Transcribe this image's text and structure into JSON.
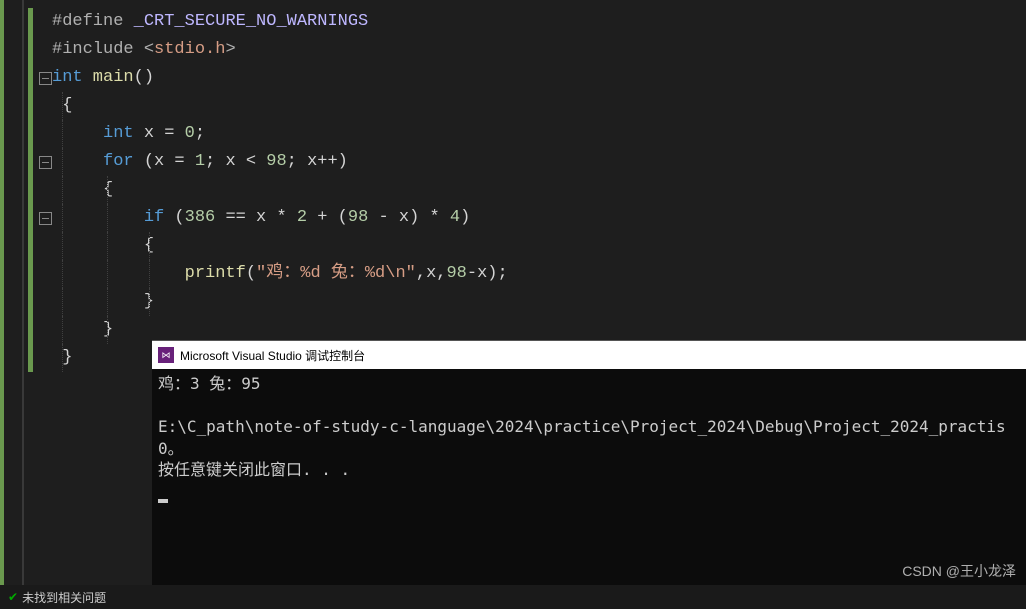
{
  "code": {
    "l1_define": "#define",
    "l1_macro": " _CRT_SECURE_NO_WARNINGS",
    "l2_include": "#include ",
    "l2_open": "<",
    "l2_hdr": "stdio.h",
    "l2_close": ">",
    "l3_int": "int",
    "l3_main": " main",
    "l3_par": "()",
    "l4_brace": "{",
    "l5_int": "int",
    "l5_rest": " x = ",
    "l5_zero": "0",
    "l5_semi": ";",
    "l6_for": "for",
    "l6_a": " (x = ",
    "l6_1": "1",
    "l6_b": "; x < ",
    "l6_98": "98",
    "l6_c": "; x++)",
    "l7_brace": "{",
    "l8_if": "if",
    "l8_a": " (",
    "l8_386": "386",
    "l8_b": " == x * ",
    "l8_2": "2",
    "l8_c": " + (",
    "l8_98": "98",
    "l8_d": " - x) * ",
    "l8_4": "4",
    "l8_e": ")",
    "l9_brace": "{",
    "l10_printf": "printf",
    "l10_a": "(",
    "l10_str": "\"鸡：%d 兔：%d\\n\"",
    "l10_b": ",x,",
    "l10_98": "98",
    "l10_c": "-x);",
    "l11_brace": "}",
    "l12_brace": "}",
    "l13_brace": "}"
  },
  "console": {
    "title": "Microsoft Visual Studio 调试控制台",
    "line1": "鸡：3 兔：95",
    "line2": "E:\\C_path\\note-of-study-c-language\\2024\\practice\\Project_2024\\Debug\\Project_2024_practis",
    "line3": "0。",
    "line4": "按任意键关闭此窗口. . ."
  },
  "status": {
    "msg": "未找到相关问题"
  },
  "watermark": "CSDN @王小龙泽"
}
